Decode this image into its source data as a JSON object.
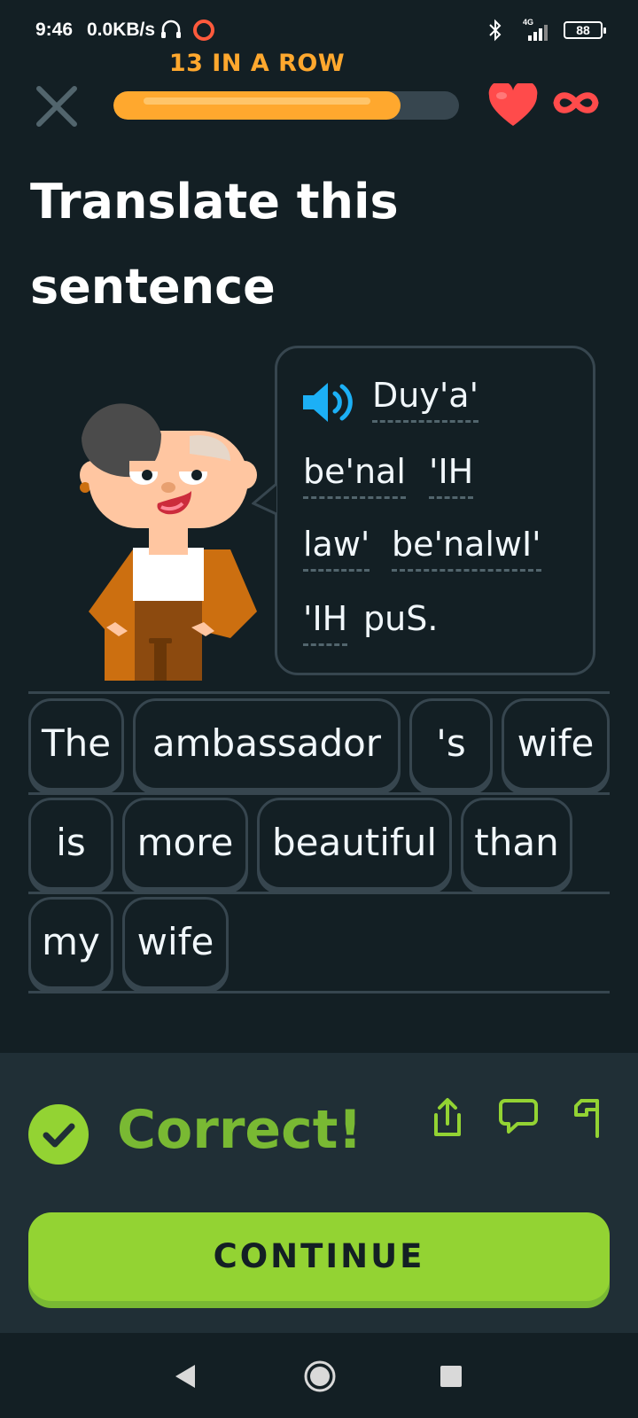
{
  "status_bar": {
    "time": "9:46",
    "speed": "0.0KB/s",
    "network": "4G",
    "battery": "88"
  },
  "header": {
    "streak_label": "13 IN A ROW",
    "progress_fraction": 0.83,
    "lives": "infinite",
    "accent_color": "#ffa82e",
    "heart_color": "#ff4b4b"
  },
  "exercise": {
    "title": "Translate this sentence",
    "prompt_words": [
      "Duy'a'",
      "be'nal",
      "'IH",
      "law'",
      "be'nalwI'",
      "'IH",
      "puS."
    ]
  },
  "answer": {
    "words": [
      "The",
      "ambassador",
      "'s",
      "wife",
      "is",
      "more",
      "beautiful",
      "than",
      "my",
      "wife"
    ]
  },
  "feedback": {
    "status": "Correct!",
    "continue_label": "CONTINUE",
    "success_color": "#93d333"
  },
  "icons": [
    "close-icon",
    "heart-icon",
    "infinity-icon",
    "speaker-icon",
    "check-icon",
    "share-icon",
    "comment-icon",
    "flag-icon",
    "nav-back-icon",
    "nav-home-icon",
    "nav-recent-icon"
  ]
}
